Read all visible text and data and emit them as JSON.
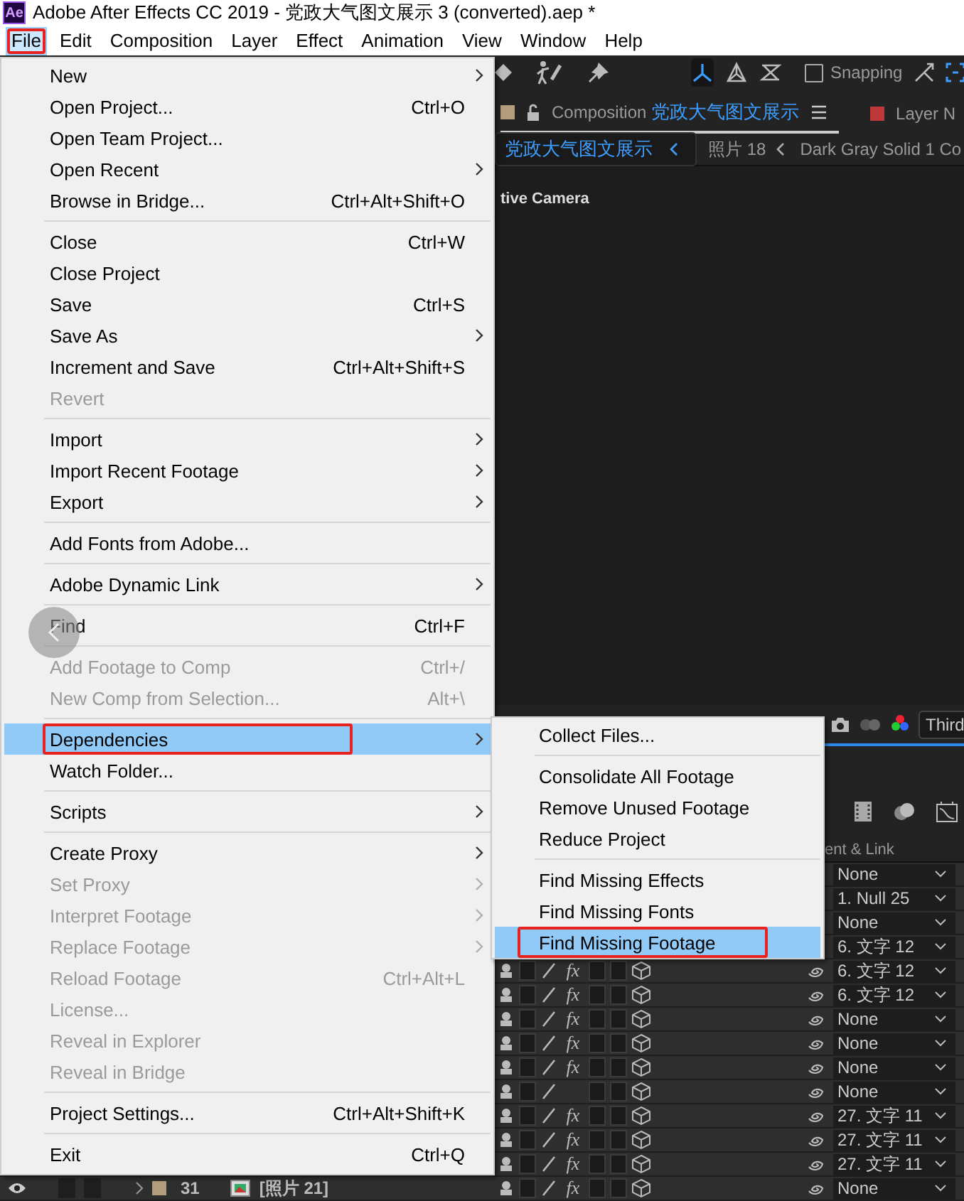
{
  "window": {
    "app_icon": "Ae",
    "title": "Adobe After Effects CC 2019 - 党政大气图文展示 3 (converted).aep *"
  },
  "menu_bar": [
    {
      "label": "File",
      "selected": true
    },
    {
      "label": "Edit",
      "selected": false
    },
    {
      "label": "Composition",
      "selected": false
    },
    {
      "label": "Layer",
      "selected": false
    },
    {
      "label": "Effect",
      "selected": false
    },
    {
      "label": "Animation",
      "selected": false
    },
    {
      "label": "View",
      "selected": false
    },
    {
      "label": "Window",
      "selected": false
    },
    {
      "label": "Help",
      "selected": false
    }
  ],
  "file_menu": {
    "groups": [
      [
        {
          "label": "New",
          "submenu": true,
          "disabled": false,
          "selected": false
        },
        {
          "label": "Open Project...",
          "shortcut": "Ctrl+O",
          "submenu": false,
          "disabled": false,
          "selected": false
        },
        {
          "label": "Open Team Project...",
          "submenu": false,
          "disabled": false,
          "selected": false
        },
        {
          "label": "Open Recent",
          "submenu": true,
          "disabled": false,
          "selected": false
        },
        {
          "label": "Browse in Bridge...",
          "shortcut": "Ctrl+Alt+Shift+O",
          "submenu": false,
          "disabled": false,
          "selected": false
        }
      ],
      [
        {
          "label": "Close",
          "shortcut": "Ctrl+W",
          "submenu": false,
          "disabled": false,
          "selected": false
        },
        {
          "label": "Close Project",
          "submenu": false,
          "disabled": false,
          "selected": false
        },
        {
          "label": "Save",
          "shortcut": "Ctrl+S",
          "submenu": false,
          "disabled": false,
          "selected": false
        },
        {
          "label": "Save As",
          "submenu": true,
          "disabled": false,
          "selected": false
        },
        {
          "label": "Increment and Save",
          "shortcut": "Ctrl+Alt+Shift+S",
          "submenu": false,
          "disabled": false,
          "selected": false
        },
        {
          "label": "Revert",
          "submenu": false,
          "disabled": true,
          "selected": false
        }
      ],
      [
        {
          "label": "Import",
          "submenu": true,
          "disabled": false,
          "selected": false
        },
        {
          "label": "Import Recent Footage",
          "submenu": true,
          "disabled": false,
          "selected": false
        },
        {
          "label": "Export",
          "submenu": true,
          "disabled": false,
          "selected": false
        }
      ],
      [
        {
          "label": "Add Fonts from Adobe...",
          "submenu": false,
          "disabled": false,
          "selected": false
        }
      ],
      [
        {
          "label": "Adobe Dynamic Link",
          "submenu": true,
          "disabled": false,
          "selected": false
        }
      ],
      [
        {
          "label": "Find",
          "shortcut": "Ctrl+F",
          "submenu": false,
          "disabled": false,
          "selected": false
        }
      ],
      [
        {
          "label": "Add Footage to Comp",
          "shortcut": "Ctrl+/",
          "submenu": false,
          "disabled": true,
          "selected": false
        },
        {
          "label": "New Comp from Selection...",
          "shortcut": "Alt+\\",
          "submenu": false,
          "disabled": true,
          "selected": false
        }
      ],
      [
        {
          "label": "Dependencies",
          "submenu": true,
          "disabled": false,
          "selected": true
        },
        {
          "label": "Watch Folder...",
          "submenu": false,
          "disabled": false,
          "selected": false
        }
      ],
      [
        {
          "label": "Scripts",
          "submenu": true,
          "disabled": false,
          "selected": false
        }
      ],
      [
        {
          "label": "Create Proxy",
          "submenu": true,
          "disabled": false,
          "selected": false
        },
        {
          "label": "Set Proxy",
          "submenu": true,
          "disabled": true,
          "selected": false
        },
        {
          "label": "Interpret Footage",
          "submenu": true,
          "disabled": true,
          "selected": false
        },
        {
          "label": "Replace Footage",
          "submenu": true,
          "disabled": true,
          "selected": false
        },
        {
          "label": "Reload Footage",
          "shortcut": "Ctrl+Alt+L",
          "submenu": false,
          "disabled": true,
          "selected": false
        },
        {
          "label": "License...",
          "submenu": false,
          "disabled": true,
          "selected": false
        },
        {
          "label": "Reveal in Explorer",
          "submenu": false,
          "disabled": true,
          "selected": false
        },
        {
          "label": "Reveal in Bridge",
          "submenu": false,
          "disabled": true,
          "selected": false
        }
      ],
      [
        {
          "label": "Project Settings...",
          "shortcut": "Ctrl+Alt+Shift+K",
          "submenu": false,
          "disabled": false,
          "selected": false
        }
      ],
      [
        {
          "label": "Exit",
          "shortcut": "Ctrl+Q",
          "submenu": false,
          "disabled": false,
          "selected": false
        }
      ]
    ]
  },
  "dependencies_submenu": {
    "groups": [
      [
        {
          "label": "Collect Files...",
          "selected": false
        }
      ],
      [
        {
          "label": "Consolidate All Footage",
          "selected": false
        },
        {
          "label": "Remove Unused Footage",
          "selected": false
        },
        {
          "label": "Reduce Project",
          "selected": false
        }
      ],
      [
        {
          "label": "Find Missing Effects",
          "selected": false
        },
        {
          "label": "Find Missing Fonts",
          "selected": false
        },
        {
          "label": "Find Missing Footage",
          "selected": true
        }
      ]
    ]
  },
  "toolbar": {
    "axis_modes": [
      {
        "selected": true
      },
      {
        "selected": false
      },
      {
        "selected": false
      }
    ],
    "snapping": {
      "label": "Snapping",
      "checked": false
    }
  },
  "composition_panel": {
    "tabs": [
      {
        "kind": "composition",
        "prefix": "Composition",
        "name": "党政大气图文展示",
        "color": "#b29d7c",
        "selected": true
      },
      {
        "kind": "layer",
        "prefix": "Layer N",
        "color": "#c0393a",
        "selected": false
      }
    ],
    "breadcrumbs": [
      {
        "label": "党政大气图文展示",
        "selected": true
      },
      {
        "label": "照片 18",
        "selected": false
      },
      {
        "label": "Dark Gray Solid 1 Co",
        "selected": false
      }
    ],
    "viewer_label": "tive Camera",
    "view_dropdown": "Third"
  },
  "timeline": {
    "column_header": "ent & Link",
    "rows": [
      {
        "parent": "None"
      },
      {
        "parent": "1. Null 25"
      },
      {
        "parent": "None"
      },
      {
        "parent": "6. 文字 12"
      },
      {
        "parent": "6. 文字 12",
        "switches": true,
        "fx": "fx"
      },
      {
        "parent": "6. 文字 12",
        "switches": true,
        "fx": "fx"
      },
      {
        "parent": "None",
        "switches": true,
        "fx": "fx"
      },
      {
        "parent": "None",
        "switches": true,
        "fx": "fx"
      },
      {
        "parent": "None",
        "switches": true,
        "fx": "fx"
      },
      {
        "parent": "None",
        "switches": true
      },
      {
        "parent": "27. 文字 11",
        "switches": true,
        "fx": "fx"
      },
      {
        "parent": "27. 文字 11",
        "switches": true,
        "fx": "fx"
      },
      {
        "parent": "27. 文字 11",
        "switches": true,
        "fx": "fx"
      },
      {
        "parent": "None",
        "switches": true,
        "fx": "fx",
        "layer": {
          "number": "31",
          "name": "[照片 21]",
          "color": "#b29d7c"
        }
      }
    ]
  }
}
